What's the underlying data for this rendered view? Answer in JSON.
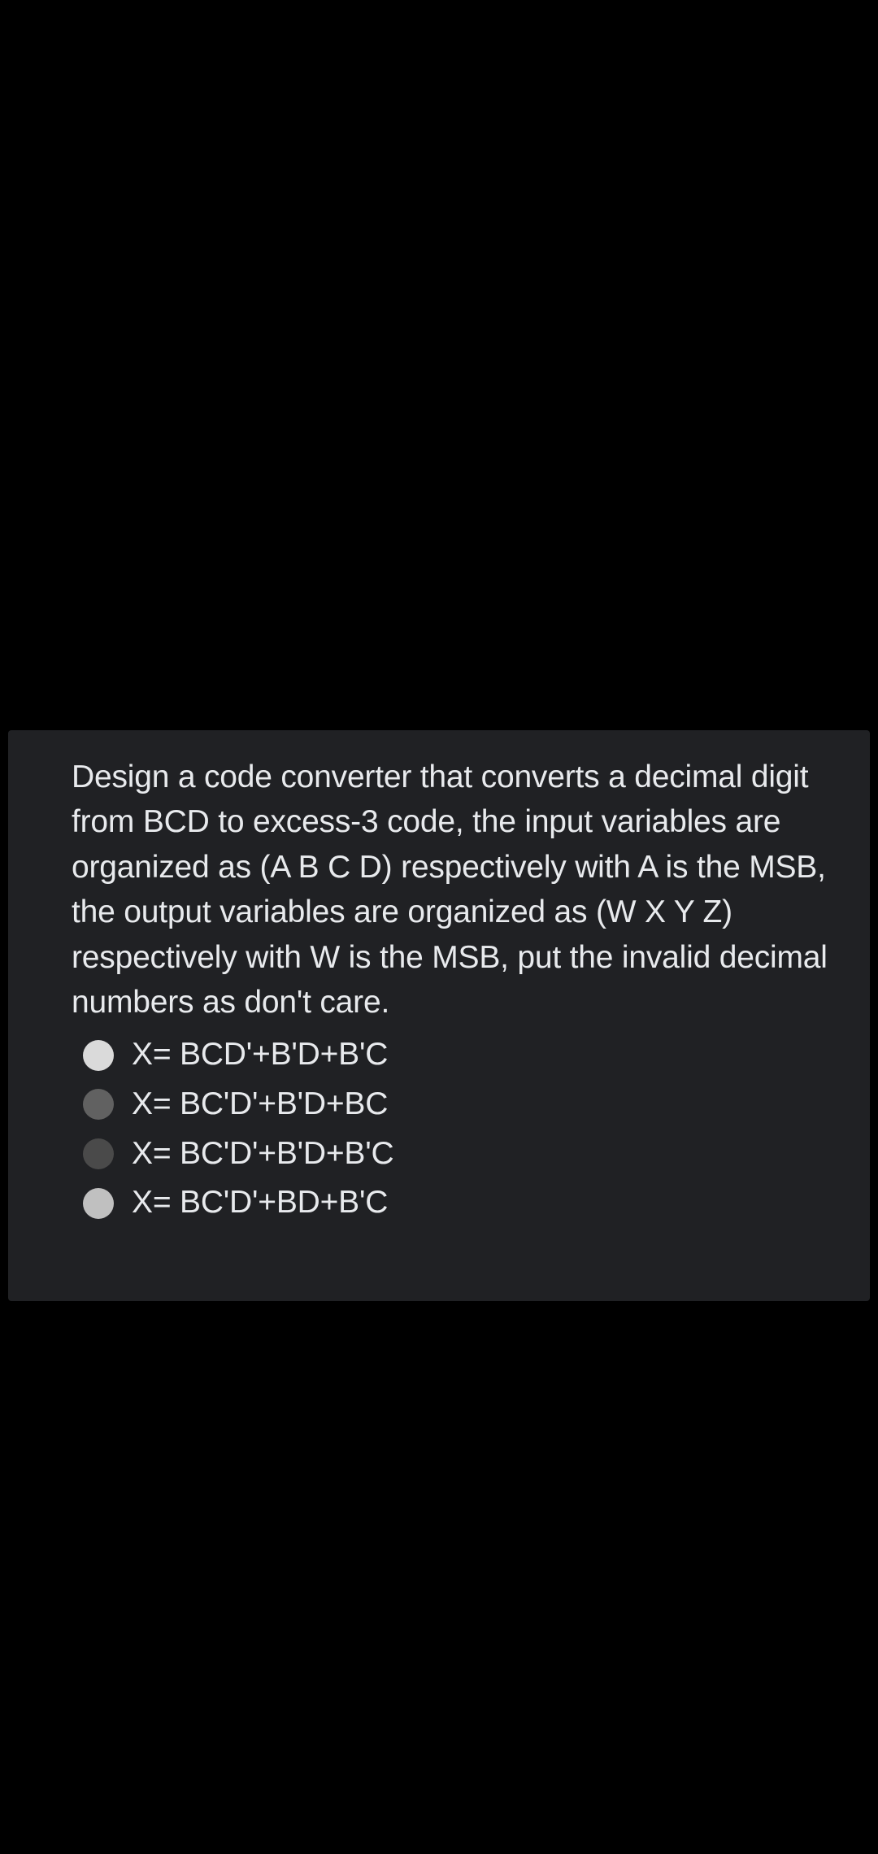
{
  "question": {
    "prompt": "Design a code converter that converts a decimal digit from BCD to excess-3 code, the input variables are organized as (A B C D) respectively with A is the MSB, the output variables are organized as (W X Y Z) respectively with W is the MSB, put the invalid decimal numbers as don't care.",
    "options": [
      {
        "text": "X= BCD'+B'D+B'C",
        "shade": "light"
      },
      {
        "text": "X= BC'D'+B'D+BC",
        "shade": "mid"
      },
      {
        "text": "X= BC'D'+B'D+B'C",
        "shade": "dark"
      },
      {
        "text": "X= BC'D'+BD+B'C",
        "shade": "lighter"
      }
    ]
  }
}
